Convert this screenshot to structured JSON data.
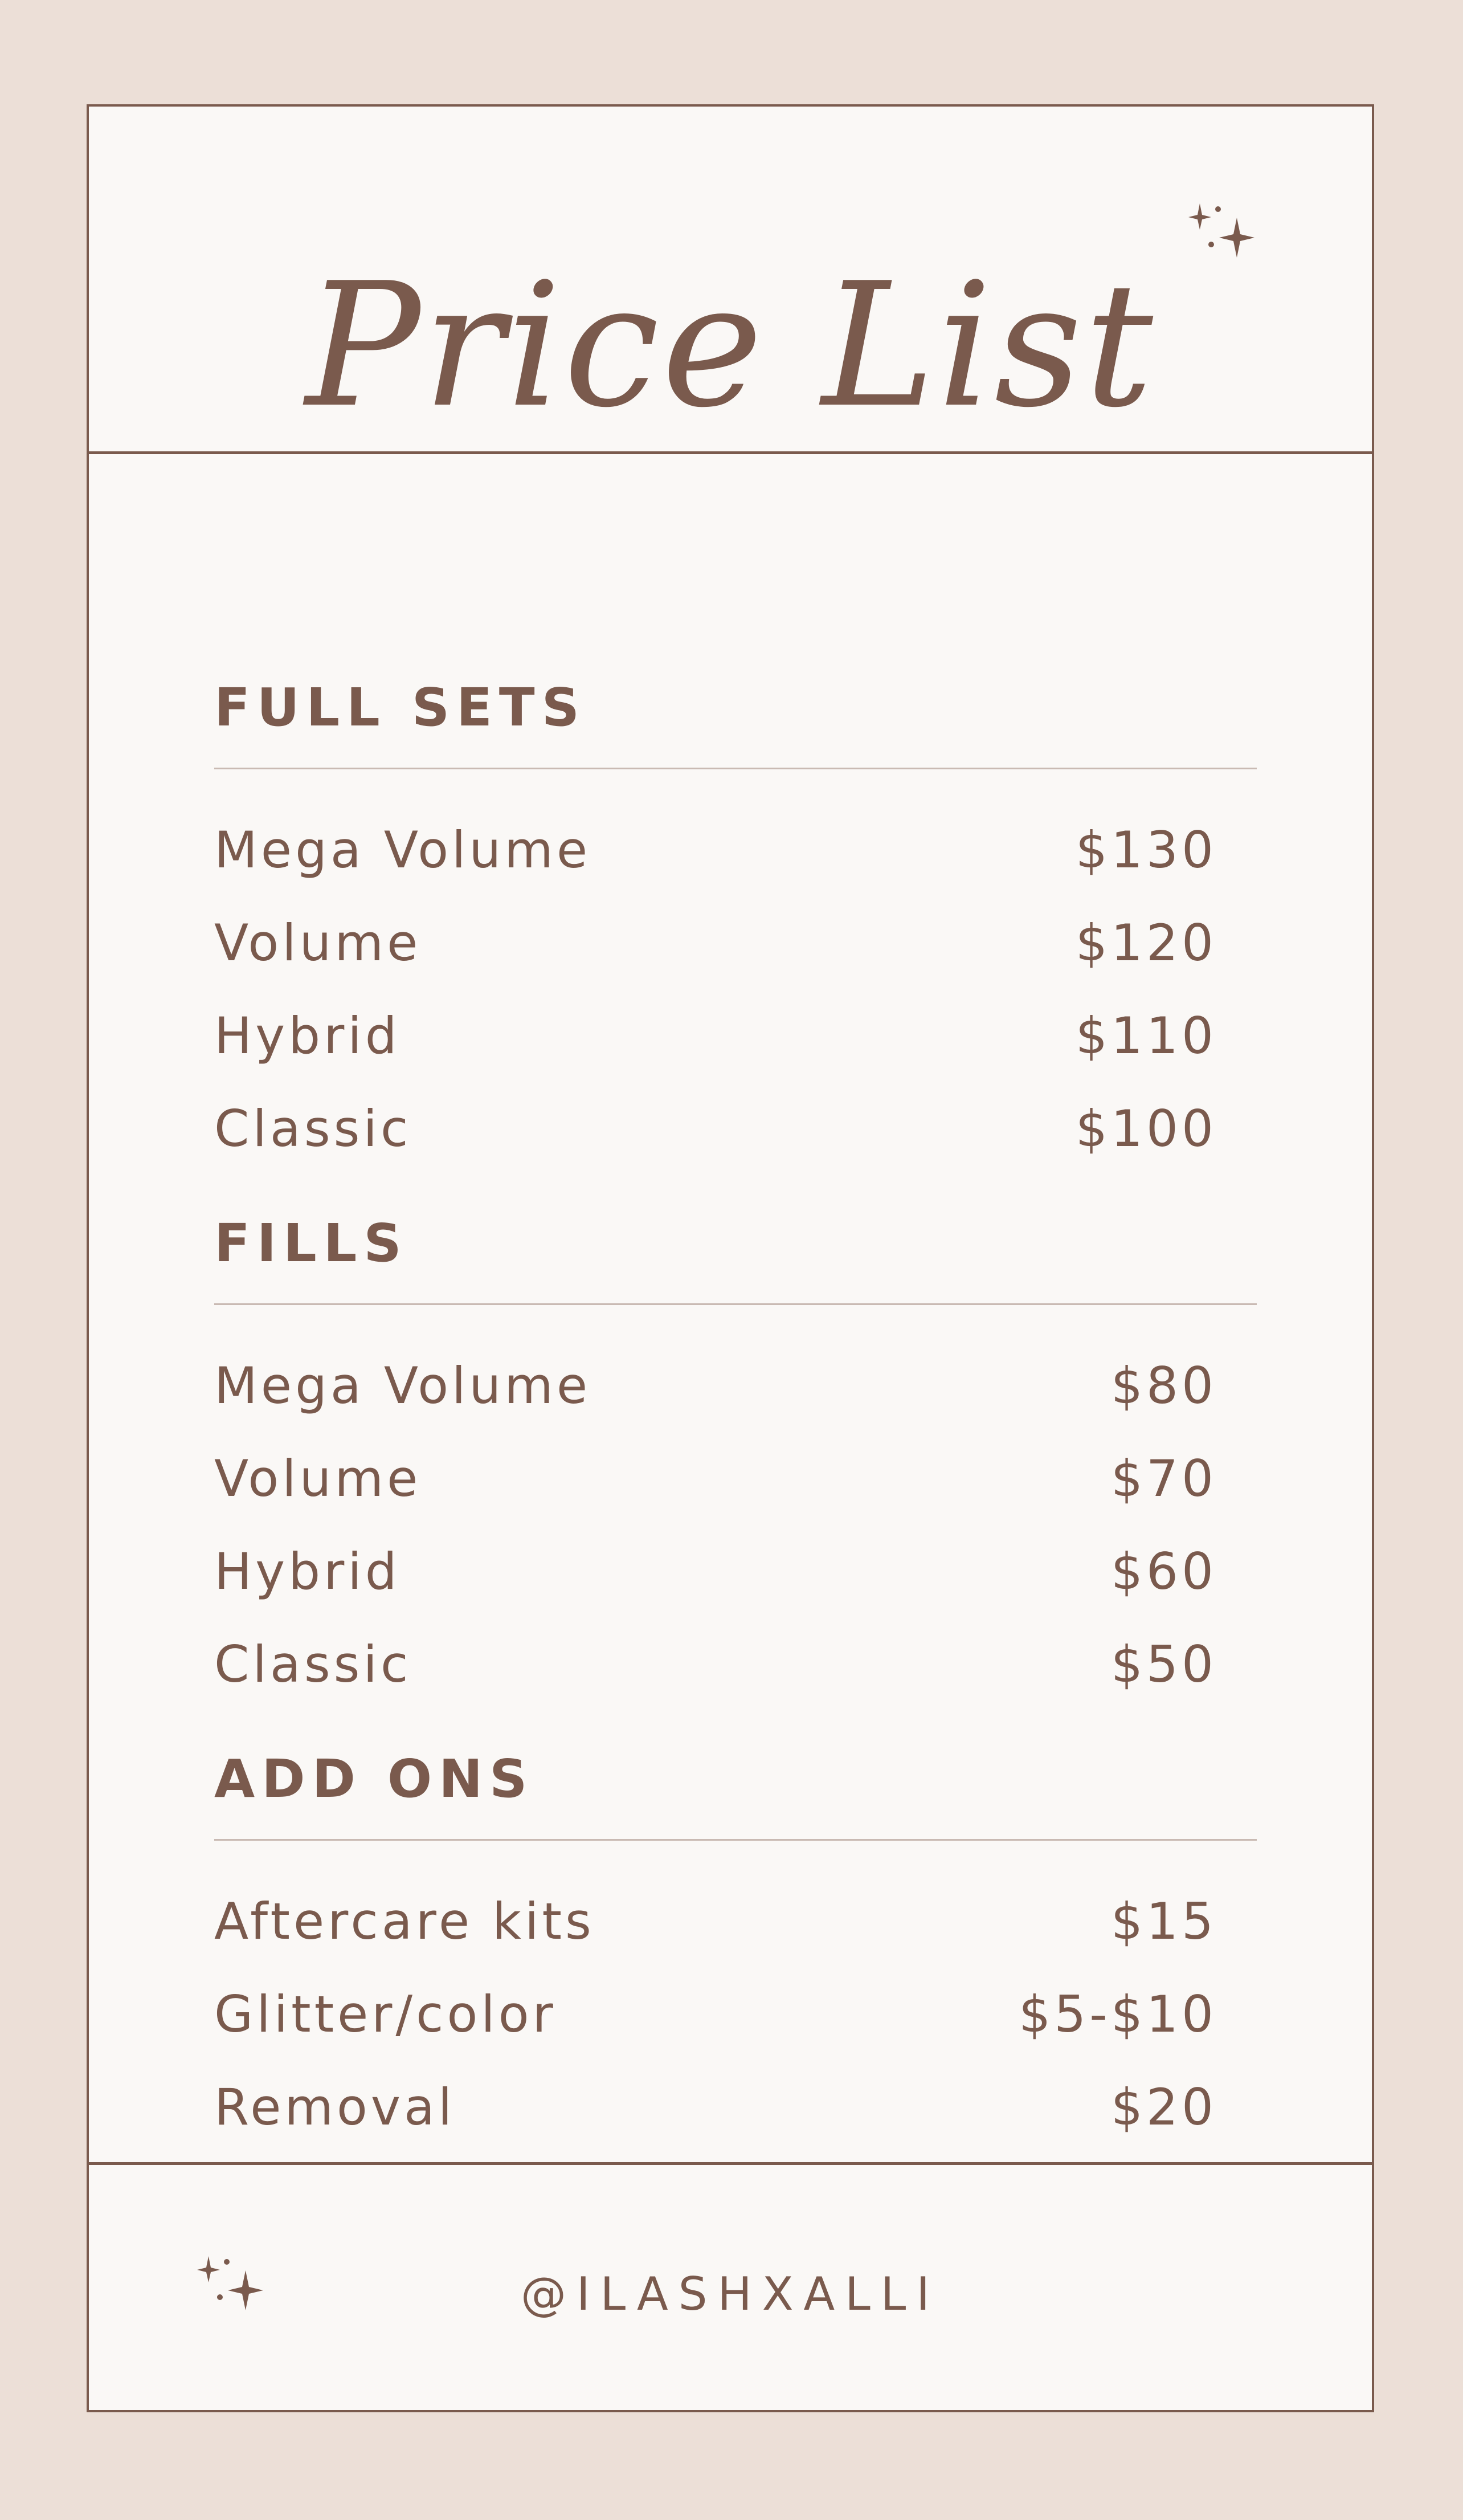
{
  "title": "Price List",
  "colors": {
    "background": "#ecdfd7",
    "card": "#faf8f6",
    "accent": "#7a5a4d",
    "rule": "#c9bab3"
  },
  "icons": {
    "header_decoration": "sparkles-icon",
    "footer_decoration": "sparkles-icon"
  },
  "sections": [
    {
      "title": "FULL SETS",
      "items": [
        {
          "name": "Mega Volume",
          "price": "$130"
        },
        {
          "name": "Volume",
          "price": "$120"
        },
        {
          "name": "Hybrid",
          "price": "$110"
        },
        {
          "name": "Classic",
          "price": "$100"
        }
      ]
    },
    {
      "title": "FILLS",
      "items": [
        {
          "name": "Mega Volume",
          "price": "$80"
        },
        {
          "name": "Volume",
          "price": "$70"
        },
        {
          "name": "Hybrid",
          "price": "$60"
        },
        {
          "name": "Classic",
          "price": "$50"
        }
      ]
    },
    {
      "title": "ADD ONS",
      "items": [
        {
          "name": "Aftercare kits",
          "price": "$15"
        },
        {
          "name": "Glitter/color",
          "price": "$5-$10"
        },
        {
          "name": "Removal",
          "price": "$20"
        }
      ]
    }
  ],
  "footer": {
    "handle": "@ILASHXALLI"
  }
}
